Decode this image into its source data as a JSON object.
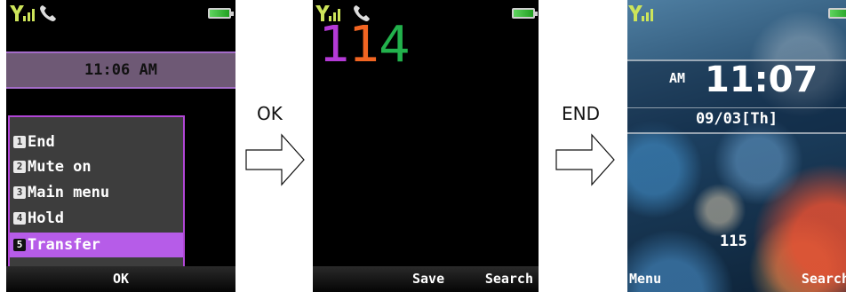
{
  "screen1": {
    "time": "11:06 AM",
    "menu": [
      {
        "num": "1",
        "label": "End"
      },
      {
        "num": "2",
        "label": "Mute on"
      },
      {
        "num": "3",
        "label": "Main menu"
      },
      {
        "num": "4",
        "label": "Hold"
      },
      {
        "num": "5",
        "label": "Transfer",
        "selected": true
      }
    ],
    "soft_center": "OK"
  },
  "arrow1": {
    "label": "OK"
  },
  "screen2": {
    "digits": [
      {
        "char": "1",
        "color": "#b43ad6"
      },
      {
        "char": "1",
        "color": "#f26522"
      },
      {
        "char": "4",
        "color": "#22b14c"
      }
    ],
    "soft_left": "Save",
    "soft_right": "Search"
  },
  "arrow2": {
    "label": "END"
  },
  "screen3": {
    "ampm": "AM",
    "time": "11:07",
    "date": "09/03[Th]",
    "dialed": "115",
    "soft_left": "Menu",
    "soft_right": "Search"
  },
  "colors": {
    "menu_highlight": "#b65ce8",
    "menu_border": "#b146d6",
    "timebar": "#6e5975"
  }
}
